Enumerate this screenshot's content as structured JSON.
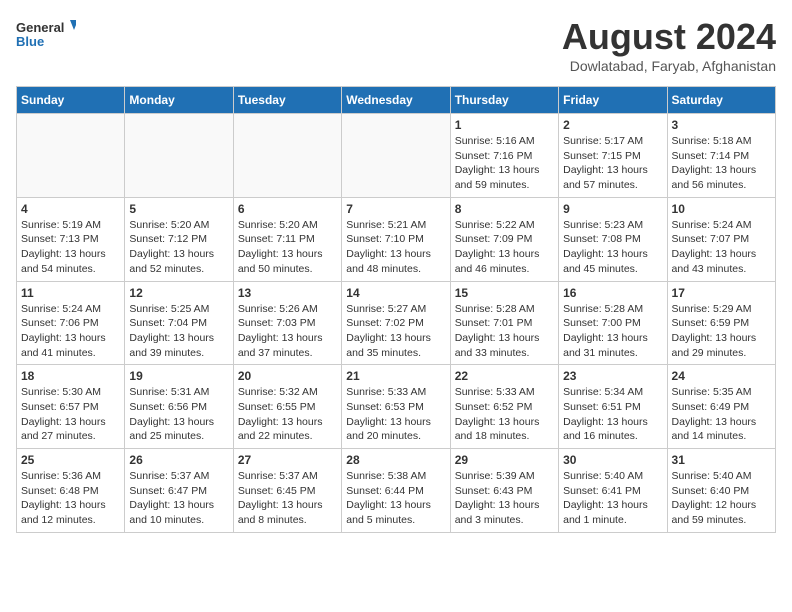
{
  "header": {
    "logo_line1": "General",
    "logo_line2": "Blue",
    "month_title": "August 2024",
    "location": "Dowlatabad, Faryab, Afghanistan"
  },
  "weekdays": [
    "Sunday",
    "Monday",
    "Tuesday",
    "Wednesday",
    "Thursday",
    "Friday",
    "Saturday"
  ],
  "weeks": [
    [
      {
        "day": "",
        "info": ""
      },
      {
        "day": "",
        "info": ""
      },
      {
        "day": "",
        "info": ""
      },
      {
        "day": "",
        "info": ""
      },
      {
        "day": "1",
        "info": "Sunrise: 5:16 AM\nSunset: 7:16 PM\nDaylight: 13 hours\nand 59 minutes."
      },
      {
        "day": "2",
        "info": "Sunrise: 5:17 AM\nSunset: 7:15 PM\nDaylight: 13 hours\nand 57 minutes."
      },
      {
        "day": "3",
        "info": "Sunrise: 5:18 AM\nSunset: 7:14 PM\nDaylight: 13 hours\nand 56 minutes."
      }
    ],
    [
      {
        "day": "4",
        "info": "Sunrise: 5:19 AM\nSunset: 7:13 PM\nDaylight: 13 hours\nand 54 minutes."
      },
      {
        "day": "5",
        "info": "Sunrise: 5:20 AM\nSunset: 7:12 PM\nDaylight: 13 hours\nand 52 minutes."
      },
      {
        "day": "6",
        "info": "Sunrise: 5:20 AM\nSunset: 7:11 PM\nDaylight: 13 hours\nand 50 minutes."
      },
      {
        "day": "7",
        "info": "Sunrise: 5:21 AM\nSunset: 7:10 PM\nDaylight: 13 hours\nand 48 minutes."
      },
      {
        "day": "8",
        "info": "Sunrise: 5:22 AM\nSunset: 7:09 PM\nDaylight: 13 hours\nand 46 minutes."
      },
      {
        "day": "9",
        "info": "Sunrise: 5:23 AM\nSunset: 7:08 PM\nDaylight: 13 hours\nand 45 minutes."
      },
      {
        "day": "10",
        "info": "Sunrise: 5:24 AM\nSunset: 7:07 PM\nDaylight: 13 hours\nand 43 minutes."
      }
    ],
    [
      {
        "day": "11",
        "info": "Sunrise: 5:24 AM\nSunset: 7:06 PM\nDaylight: 13 hours\nand 41 minutes."
      },
      {
        "day": "12",
        "info": "Sunrise: 5:25 AM\nSunset: 7:04 PM\nDaylight: 13 hours\nand 39 minutes."
      },
      {
        "day": "13",
        "info": "Sunrise: 5:26 AM\nSunset: 7:03 PM\nDaylight: 13 hours\nand 37 minutes."
      },
      {
        "day": "14",
        "info": "Sunrise: 5:27 AM\nSunset: 7:02 PM\nDaylight: 13 hours\nand 35 minutes."
      },
      {
        "day": "15",
        "info": "Sunrise: 5:28 AM\nSunset: 7:01 PM\nDaylight: 13 hours\nand 33 minutes."
      },
      {
        "day": "16",
        "info": "Sunrise: 5:28 AM\nSunset: 7:00 PM\nDaylight: 13 hours\nand 31 minutes."
      },
      {
        "day": "17",
        "info": "Sunrise: 5:29 AM\nSunset: 6:59 PM\nDaylight: 13 hours\nand 29 minutes."
      }
    ],
    [
      {
        "day": "18",
        "info": "Sunrise: 5:30 AM\nSunset: 6:57 PM\nDaylight: 13 hours\nand 27 minutes."
      },
      {
        "day": "19",
        "info": "Sunrise: 5:31 AM\nSunset: 6:56 PM\nDaylight: 13 hours\nand 25 minutes."
      },
      {
        "day": "20",
        "info": "Sunrise: 5:32 AM\nSunset: 6:55 PM\nDaylight: 13 hours\nand 22 minutes."
      },
      {
        "day": "21",
        "info": "Sunrise: 5:33 AM\nSunset: 6:53 PM\nDaylight: 13 hours\nand 20 minutes."
      },
      {
        "day": "22",
        "info": "Sunrise: 5:33 AM\nSunset: 6:52 PM\nDaylight: 13 hours\nand 18 minutes."
      },
      {
        "day": "23",
        "info": "Sunrise: 5:34 AM\nSunset: 6:51 PM\nDaylight: 13 hours\nand 16 minutes."
      },
      {
        "day": "24",
        "info": "Sunrise: 5:35 AM\nSunset: 6:49 PM\nDaylight: 13 hours\nand 14 minutes."
      }
    ],
    [
      {
        "day": "25",
        "info": "Sunrise: 5:36 AM\nSunset: 6:48 PM\nDaylight: 13 hours\nand 12 minutes."
      },
      {
        "day": "26",
        "info": "Sunrise: 5:37 AM\nSunset: 6:47 PM\nDaylight: 13 hours\nand 10 minutes."
      },
      {
        "day": "27",
        "info": "Sunrise: 5:37 AM\nSunset: 6:45 PM\nDaylight: 13 hours\nand 8 minutes."
      },
      {
        "day": "28",
        "info": "Sunrise: 5:38 AM\nSunset: 6:44 PM\nDaylight: 13 hours\nand 5 minutes."
      },
      {
        "day": "29",
        "info": "Sunrise: 5:39 AM\nSunset: 6:43 PM\nDaylight: 13 hours\nand 3 minutes."
      },
      {
        "day": "30",
        "info": "Sunrise: 5:40 AM\nSunset: 6:41 PM\nDaylight: 13 hours\nand 1 minute."
      },
      {
        "day": "31",
        "info": "Sunrise: 5:40 AM\nSunset: 6:40 PM\nDaylight: 12 hours\nand 59 minutes."
      }
    ]
  ]
}
